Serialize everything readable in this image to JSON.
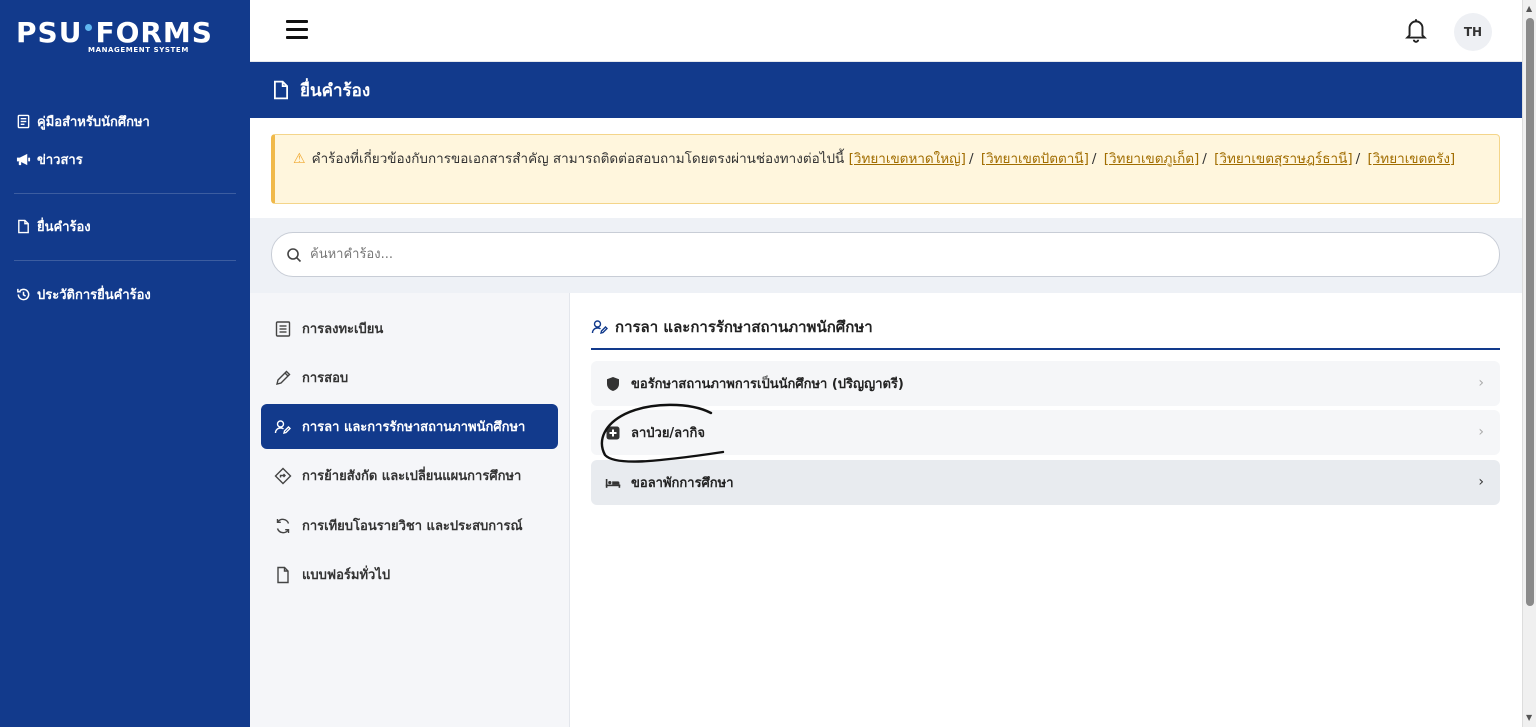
{
  "sidebar": {
    "logo_brand_left": "PSU",
    "logo_brand_right": "FORMS",
    "logo_subtitle": "MANAGEMENT SYSTEM",
    "items": [
      {
        "label": "คู่มือสำหรับนักศึกษา",
        "icon": "book-icon"
      },
      {
        "label": "ข่าวสาร",
        "icon": "megaphone-icon"
      },
      {
        "label": "ยื่นคำร้อง",
        "icon": "file-icon"
      },
      {
        "label": "ประวัติการยื่นคำร้อง",
        "icon": "history-icon"
      }
    ]
  },
  "topbar": {
    "avatar_initials": "TH"
  },
  "header": {
    "title": "ยื่นคำร้อง"
  },
  "alert": {
    "text": "คำร้องที่เกี่ยวข้องกับการขอเอกสารสำคัญ สามารถติดต่อสอบถามโดยตรงผ่านช่องทางต่อไปนี้",
    "links": [
      "[วิทยาเขตหาดใหญ่]",
      "[วิทยาเขตปัตตานี]",
      "[วิทยาเขตภูเก็ต]",
      "[วิทยาเขตสุราษฎร์ธานี]",
      "[วิทยาเขตตรัง]"
    ],
    "separator": "/"
  },
  "search": {
    "placeholder": "ค้นหาคำร้อง..."
  },
  "categories": [
    {
      "label": "การลงทะเบียน",
      "icon": "list-icon"
    },
    {
      "label": "การสอบ",
      "icon": "pencil-icon"
    },
    {
      "label": "การลา และการรักษาสถานภาพนักศึกษา",
      "icon": "user-edit-icon",
      "active": true
    },
    {
      "label": "การย้ายสังกัด และเปลี่ยนแผนการศึกษา",
      "icon": "direction-icon"
    },
    {
      "label": "การเทียบโอนรายวิชา และประสบการณ์",
      "icon": "refresh-icon"
    },
    {
      "label": "แบบฟอร์มทั่วไป",
      "icon": "file-icon"
    }
  ],
  "panel": {
    "title": "การลา และการรักษาสถานภาพนักศึกษา",
    "rows": [
      {
        "label": "ขอรักษาสถานภาพการเป็นนักศึกษา (ปริญญาตรี)",
        "icon": "shield-icon"
      },
      {
        "label": "ลาป่วย/ลากิจ",
        "icon": "medical-icon"
      },
      {
        "label": "ขอลาพักการศึกษา",
        "icon": "bed-icon"
      }
    ],
    "chevron": "›"
  },
  "colors": {
    "primary": "#123a8c",
    "alert_bg": "#fff6dd",
    "alert_border": "#f0b94a",
    "link": "#a16d00"
  }
}
